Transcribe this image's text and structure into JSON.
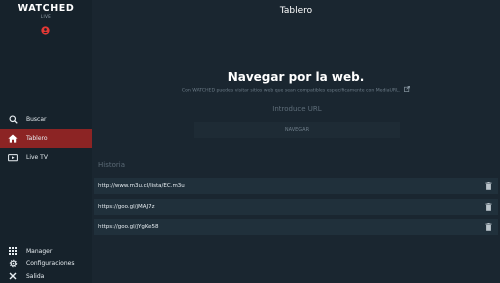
{
  "sidebar": {
    "logo": {
      "title": "WATCHED",
      "subtitle": "LIVE"
    },
    "user_icon": "user-circle-icon",
    "nav_items": [
      {
        "label": "Buscar",
        "icon": "search-icon",
        "active": false
      },
      {
        "label": "Tablero",
        "icon": "home-icon",
        "active": true
      },
      {
        "label": "Live TV",
        "icon": "tv-icon",
        "active": false
      }
    ],
    "bottom_items": [
      {
        "label": "Manager",
        "icon": "grid-icon"
      },
      {
        "label": "Configuraciones",
        "icon": "gear-icon"
      },
      {
        "label": "Salida",
        "icon": "close-icon"
      }
    ]
  },
  "main": {
    "page_title": "Tablero",
    "headline": "Navegar por la web.",
    "subline": "Con WATCHED puedes visitar sitios web que sean compatibles específicamente con MediaURL.",
    "url_input": {
      "placeholder": "Introduce URL",
      "value": ""
    },
    "navigate_label": "NAVEGAR",
    "history_title": "Historia",
    "history": [
      {
        "url": "http://www.m3u.cl/lista/EC.m3u"
      },
      {
        "url": "https://goo.gl/jMAJ7z"
      },
      {
        "url": "https://goo.gl/jYgKe58"
      }
    ]
  },
  "colors": {
    "background": "#1a2630",
    "sidebar": "#16222b",
    "accent": "#8c2424",
    "brand_red": "#e53935",
    "history_row": "#20303b"
  }
}
